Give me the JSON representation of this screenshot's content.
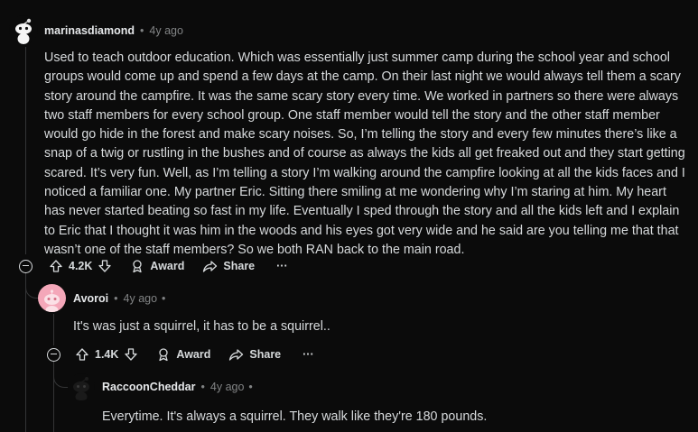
{
  "comments": [
    {
      "user": "marinasdiamond",
      "age": "4y ago",
      "body": "Used to teach outdoor education. Which was essentially just summer camp during the school year and school groups would come up and spend a few days at the camp. On their last night we would always tell them a scary story around the campfire. It was the same scary story every time. We worked in partners so there were always two staff members for every school group. One staff member would tell the story and the other staff member would go hide in the forest and make scary noises. So, I’m telling the story and every few minutes there’s like a snap of a twig or rustling in the bushes and of course as always the kids all get freaked out and they start getting scared. It’s very fun. Well, as I’m telling a story I’m walking around the campfire looking at all the kids faces and I noticed a familiar one. My partner Eric. Sitting there smiling at me wondering why I’m staring at him. My heart has never started beating so fast in my life. Eventually I sped through the story and all the kids left and I explain to Eric that I thought it was him in the woods and his eyes got very wide and he said are you telling me that that wasn’t one of the staff members? So we both RAN back to the main road.",
      "votes": "4.2K",
      "award_label": "Award",
      "share_label": "Share",
      "more_label": "···"
    },
    {
      "user": "Avoroi",
      "age": "4y ago",
      "body": "It's was just a squirrel, it has to be a squirrel..",
      "votes": "1.4K",
      "award_label": "Award",
      "share_label": "Share",
      "more_label": "···"
    },
    {
      "user": "RaccoonCheddar",
      "age": "4y ago",
      "body": "Everytime. It's always a squirrel. They walk like they're 180 pounds."
    }
  ],
  "separators": {
    "dot": "•"
  },
  "icons": {
    "avatar_1": "snoo-avatar-icon",
    "avatar_2": "pink-snoo-avatar-icon",
    "avatar_3": "dark-snoo-avatar-icon",
    "upvote": "upvote-arrow-icon",
    "downvote": "downvote-arrow-icon",
    "award": "award-icon",
    "share": "share-arrow-icon",
    "collapse": "collapse-minus-icon"
  },
  "colors": {
    "background": "#0b0b0b",
    "text": "#d7dadc",
    "muted": "#818384",
    "avatar_pink": "#f4a7b9"
  }
}
